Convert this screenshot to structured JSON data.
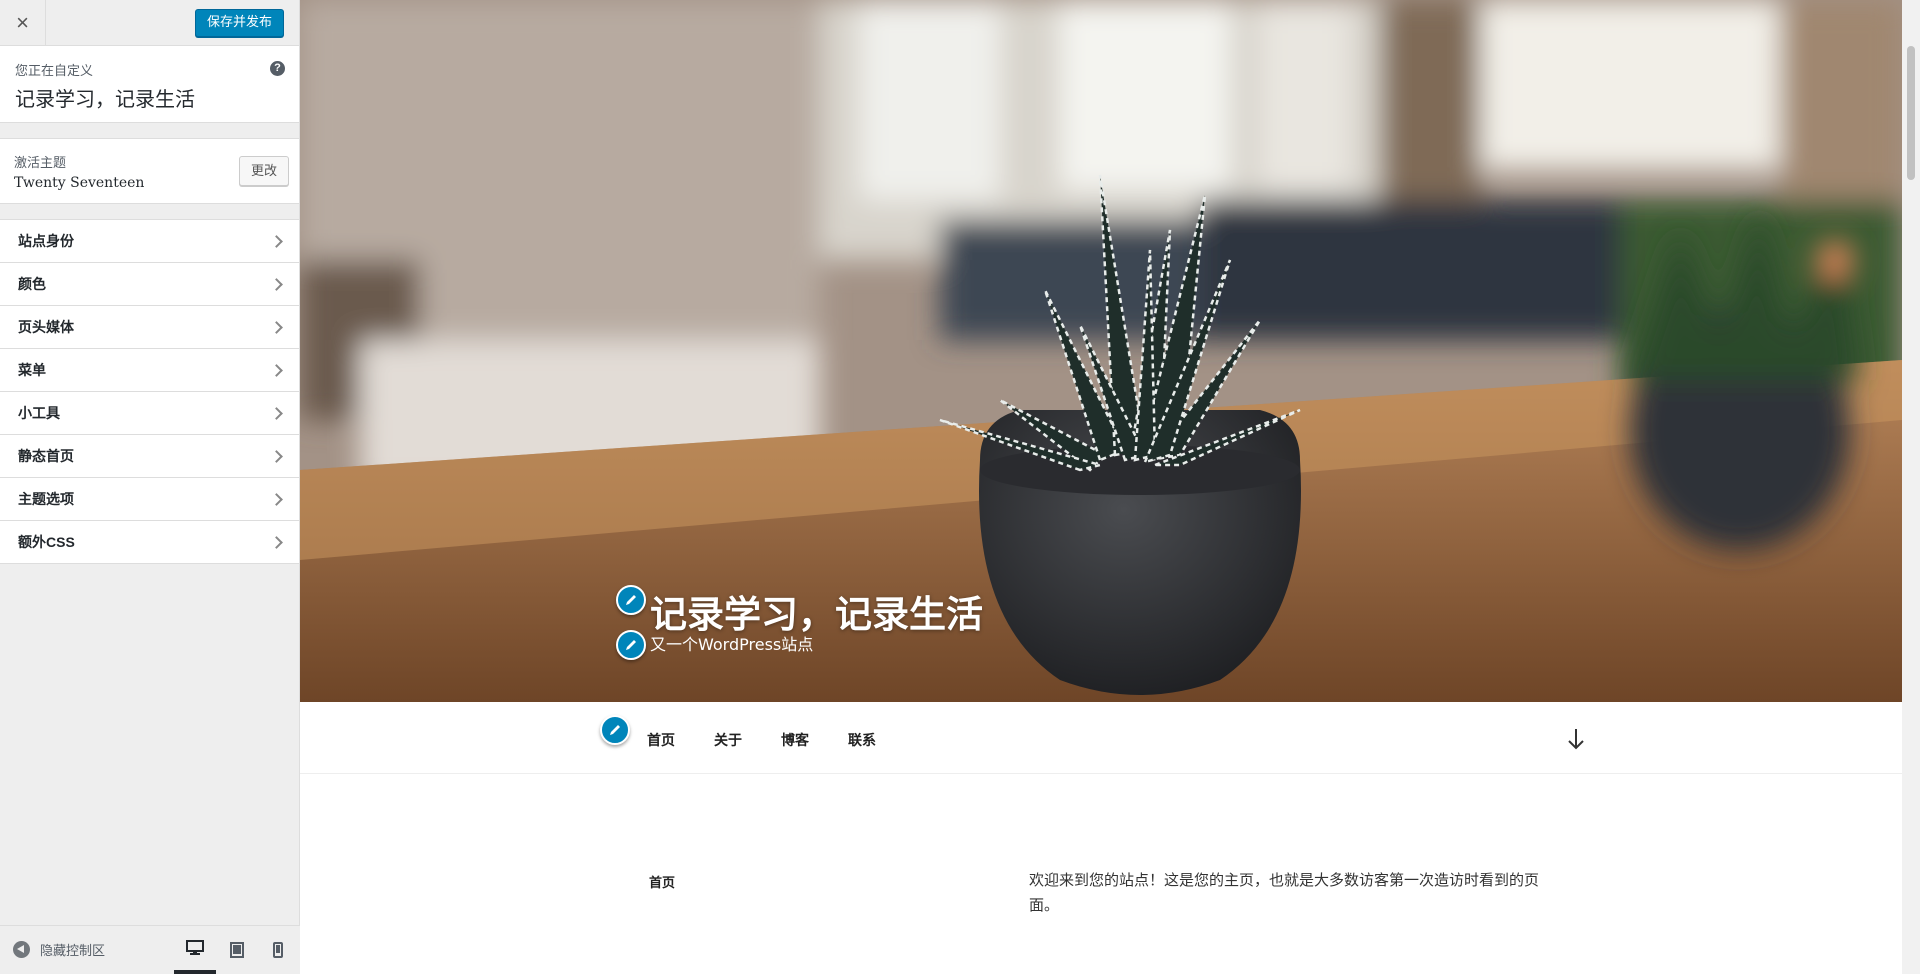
{
  "sidebar": {
    "close_label": "×",
    "publish_label": "保存并发布",
    "customizing_label": "您正在自定义",
    "site_title": "记录学习，记录生活",
    "help_label": "?",
    "theme": {
      "active_label": "激活主题",
      "name": "Twenty Seventeen",
      "change_label": "更改"
    },
    "panels": [
      {
        "label": "站点身份"
      },
      {
        "label": "颜色"
      },
      {
        "label": "页头媒体"
      },
      {
        "label": "菜单"
      },
      {
        "label": "小工具"
      },
      {
        "label": "静态首页"
      },
      {
        "label": "主题选项"
      },
      {
        "label": "额外CSS"
      }
    ],
    "footer": {
      "hide_label": "隐藏控制区",
      "devices": [
        "desktop-icon",
        "tablet-icon",
        "mobile-icon"
      ],
      "active_device": "desktop"
    }
  },
  "preview": {
    "site_title": "记录学习，记录生活",
    "tagline": "又一个WordPress站点",
    "nav": [
      {
        "label": "首页"
      },
      {
        "label": "关于"
      },
      {
        "label": "博客"
      },
      {
        "label": "联系"
      }
    ],
    "content": {
      "heading": "首页",
      "text": "欢迎来到您的站点！这是您的主页，也就是大多数访客第一次造访时看到的页面。"
    }
  },
  "colors": {
    "accent": "#0085ba",
    "sidebar_bg": "#eeeeee",
    "text": "#23282d"
  }
}
